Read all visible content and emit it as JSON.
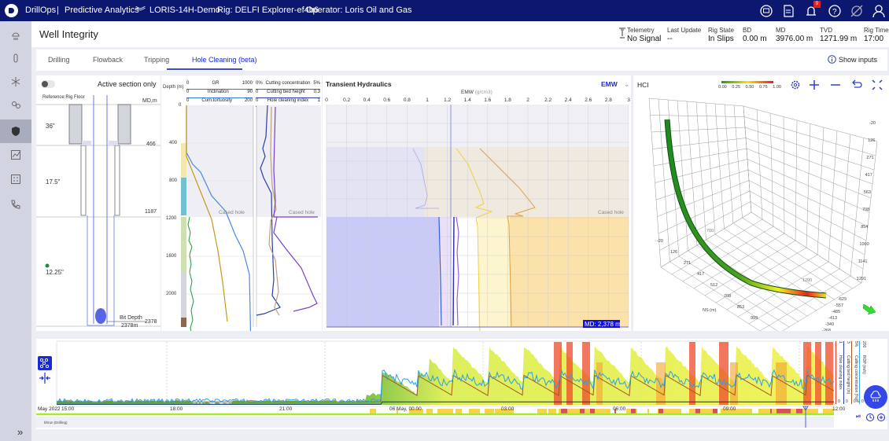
{
  "topbar": {
    "logo": "D",
    "app": "DrillOps",
    "separator": "|",
    "module": "Predictive Analytics",
    "well": "LORIS-14H-Demo",
    "rig": "Rig: DELFI Explorer-ef4b6",
    "operator": "Operator: Loris Oil and Gas",
    "notification_count": "9",
    "icons": [
      "chat-icon",
      "report-icon",
      "bell-icon",
      "help-icon",
      "satellite-off-icon",
      "user-icon"
    ]
  },
  "sidebar": {
    "items": [
      "weather-icon",
      "drill-bit-icon",
      "rig-icon",
      "team-icon",
      "well-integrity-shield-icon",
      "chart-icon",
      "dashboard-icon",
      "phone-icon"
    ],
    "active": 4,
    "expand": "»"
  },
  "header": {
    "title": "Well Integrity",
    "stats": [
      {
        "label": "Telemetry",
        "value": "No Signal"
      },
      {
        "label": "Last Update",
        "value": "--"
      },
      {
        "label": "Rig State",
        "value": "In Slips"
      },
      {
        "label": "BD",
        "value": "0.00 m"
      },
      {
        "label": "MD",
        "value": "3976.00 m"
      },
      {
        "label": "TVD",
        "value": "1271.99 m"
      },
      {
        "label": "Rig Time",
        "value": "17:00"
      }
    ]
  },
  "tabs": {
    "items": [
      "Drilling",
      "Flowback",
      "Tripping",
      "Hole Cleaning (beta)"
    ],
    "active": 3,
    "show_inputs": "Show inputs"
  },
  "wellbore": {
    "toggle_label": "Active section only",
    "toggle_on": false,
    "reference": "Reference:Rig Floor",
    "md_label": "MD,m",
    "sections": [
      {
        "size": "36\"",
        "shoe": "466"
      },
      {
        "size": "17.5\"",
        "shoe": "1187"
      },
      {
        "size": "12.25\""
      }
    ],
    "bit_depth_label": "Bit Depth",
    "bit_depth_value": "2378m",
    "bit_depth_tick": "2378"
  },
  "tracks": {
    "depth_label": "Depth",
    "depth_unit": "(m)",
    "depth_ticks": [
      "0",
      "400",
      "800",
      "1200",
      "1600",
      "2000"
    ],
    "track1": [
      {
        "min": "0",
        "name": "GR",
        "unit": "(gAPI)",
        "max": "1000",
        "color": "#2e9a4a"
      },
      {
        "min": "0",
        "name": "Inclination",
        "unit": "(deg)",
        "max": "90",
        "color": "#3a7be0"
      },
      {
        "min": "0",
        "name": "Cum.tortuosity",
        "unit": "(deg)",
        "max": "200",
        "color": "#c39a1a"
      }
    ],
    "track2": [
      {
        "min": "0%",
        "name": "Cutting concentration",
        "unit": "",
        "max": "5%",
        "color": "#a0581f"
      },
      {
        "min": "0",
        "name": "Cutting bed height",
        "unit": "(in)",
        "max": "0.3",
        "color": "#2a3fa8"
      },
      {
        "min": "0",
        "name": "Hole cleaning index",
        "unit": "",
        "max": "1",
        "color": "#7a3fd0"
      }
    ],
    "cased_hole": "Cased hole"
  },
  "hydraulics": {
    "title": "Transient Hydraulics",
    "selector": "EMW",
    "axis_label": "EMW",
    "axis_unit": "(g/cm3)",
    "ticks": [
      "0",
      "0.2",
      "0.4",
      "0.6",
      "0.8",
      "1",
      "1.2",
      "1.4",
      "1.6",
      "1.8",
      "2",
      "2.2",
      "2.4",
      "2.6",
      "2.8",
      "3"
    ],
    "cased_hole": "Cased hole",
    "md_readout": "MD: 2,378 m"
  },
  "hci": {
    "title": "HCI",
    "legend": [
      "0.00",
      "0.25",
      "0.50",
      "0.75",
      "1.00"
    ],
    "legend_colors": [
      "#1e9a1e",
      "#f5e600",
      "#e81c1c"
    ],
    "z_ticks": [
      "-20",
      "126",
      "271",
      "417",
      "563",
      "708",
      "854",
      "1000",
      "1141",
      "1291"
    ],
    "ns_ticks": [
      "-20",
      "126",
      "271",
      "417",
      "512",
      "708",
      "853",
      "999"
    ],
    "ew_ticks": [
      "-629",
      "-557",
      "-485",
      "-413",
      "-340",
      "-268",
      "-195"
    ],
    "ns_label": "NS (m)",
    "marker1": "700",
    "marker2": "1200",
    "tools": [
      "settings-icon",
      "zoom-in-icon",
      "zoom-out-icon",
      "undo-icon",
      "fullscreen-icon"
    ]
  },
  "timeline": {
    "date_label": "May 2022",
    "time_ticks": [
      "15:00",
      "18:00",
      "21:00",
      "06 May, 00:00",
      "03:00",
      "06:00",
      "09:00",
      "12:00"
    ],
    "legends": [
      {
        "name": "Hole cleaning index",
        "max": "1",
        "min": "0",
        "color": "#e0302a"
      },
      {
        "name": "Cutting bed height (in)",
        "max": "3",
        "min": "0",
        "color": "#2a3fa8"
      },
      {
        "name": "Cutting concentration (%)",
        "max": "5%",
        "min": "0%",
        "color": "#a0581f"
      },
      {
        "name": "ROP (m/h)",
        "max": "200",
        "min": "0",
        "color": "#3aa8e8"
      }
    ],
    "run_label": "bhrun (Drilling)"
  }
}
